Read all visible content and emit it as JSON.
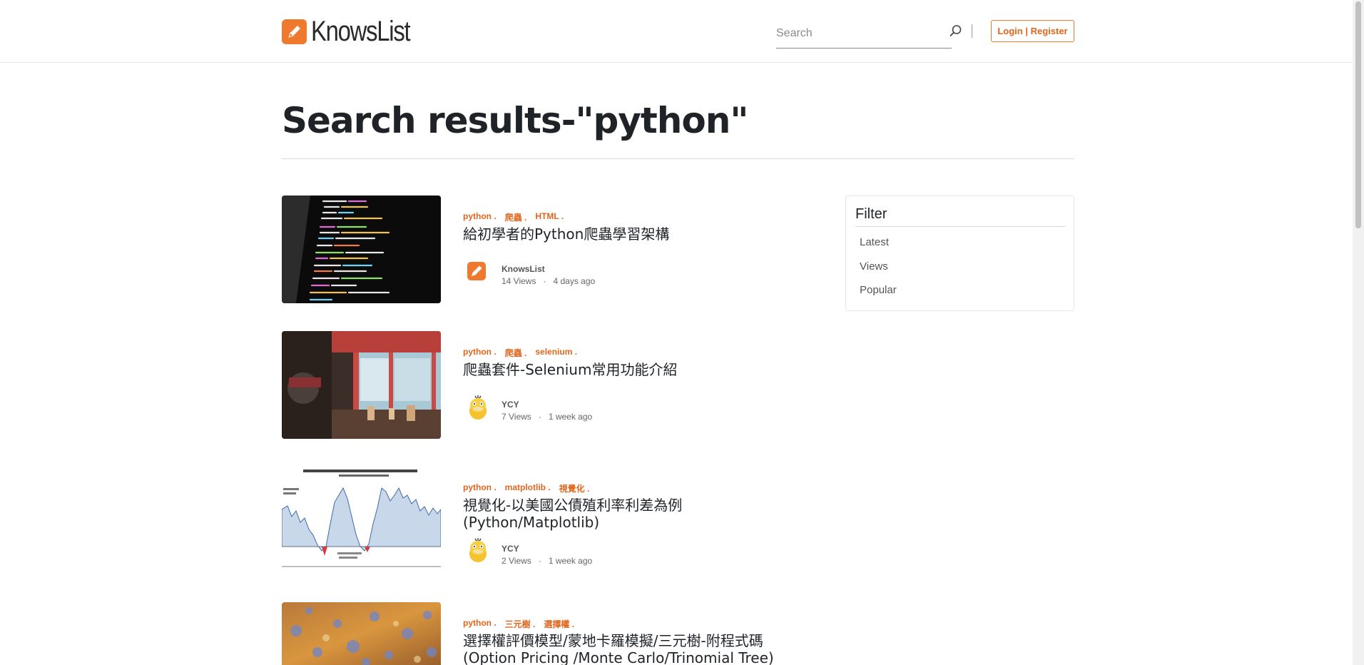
{
  "header": {
    "brand": "KnowsList",
    "search_placeholder": "Search",
    "login_label": "Login | Register"
  },
  "page": {
    "title": "Search results-\"python\""
  },
  "results": [
    {
      "tags": [
        "python",
        "爬蟲",
        "HTML"
      ],
      "title": "給初學者的Python爬蟲學習架構",
      "author": "KnowsList",
      "views": "14 Views",
      "time": "4 days ago",
      "thumb_icon": "code-screen-image",
      "avatar_icon": "knowslist-logo-icon"
    },
    {
      "tags": [
        "python",
        "爬蟲",
        "selenium"
      ],
      "title": "爬蟲套件-Selenium常用功能介紹",
      "author": "YCY",
      "views": "7 Views",
      "time": "1 week ago",
      "thumb_icon": "cafe-interior-image",
      "avatar_icon": "duck-avatar-icon"
    },
    {
      "tags": [
        "python",
        "matplotlib",
        "視覺化"
      ],
      "title": "視覺化-以美國公債殖利率利差為例(Python/Matplotlib)",
      "author": "YCY",
      "views": "2 Views",
      "time": "1 week ago",
      "thumb_icon": "yield-chart-image",
      "avatar_icon": "duck-avatar-icon"
    },
    {
      "tags": [
        "python",
        "三元樹",
        "選擇權"
      ],
      "title": "選擇權評價模型/蒙地卡羅模擬/三元樹-附程式碼(Option Pricing /Monte Carlo/Trinomial Tree)",
      "author": "",
      "views": "",
      "time": "",
      "thumb_icon": "bokeh-lights-image",
      "avatar_icon": ""
    }
  ],
  "filter": {
    "title": "Filter",
    "items": [
      "Latest",
      "Views",
      "Popular"
    ]
  },
  "colors": {
    "accent": "#ef7a2f",
    "tag": "#e2651c",
    "text": "#1f2328"
  }
}
